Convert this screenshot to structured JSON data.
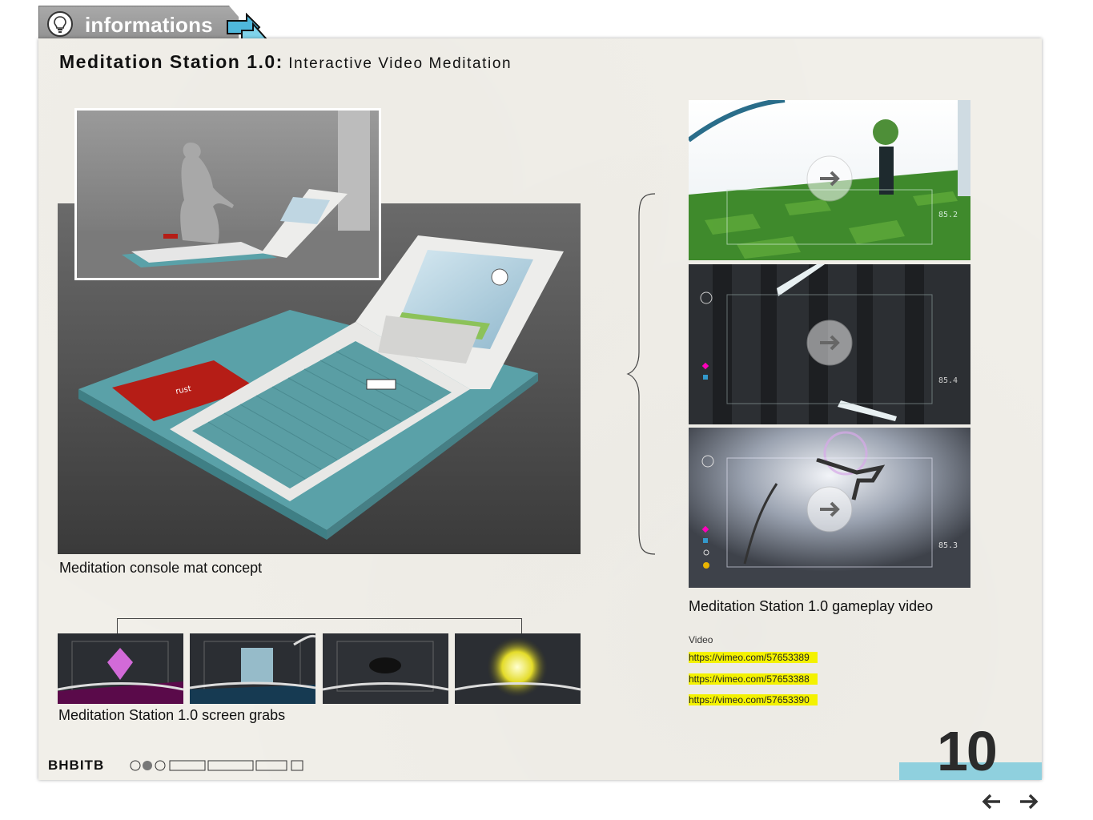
{
  "tab": {
    "label": "informations"
  },
  "header": {
    "title_main": "Meditation Station 1.0:",
    "title_sub": "Interactive Video Meditation"
  },
  "captions": {
    "mat": "Meditation console mat concept",
    "gameplay": "Meditation Station 1.0 gameplay video",
    "grabs": "Meditation Station 1.0 screen grabs"
  },
  "gameplay_frames": [
    {
      "readout": "85.2"
    },
    {
      "readout": "85.4"
    },
    {
      "readout": "85.3"
    }
  ],
  "video": {
    "label": "Video",
    "links": [
      "https://vimeo.com/57653389",
      "https://vimeo.com/57653388",
      "https://vimeo.com/57653390"
    ]
  },
  "footer": {
    "logo": "BHBITB",
    "page_number": "10"
  },
  "colors": {
    "accent": "#8fd0de",
    "highlight": "#f4f200",
    "mat_teal": "#5aa1a8",
    "mat_red": "#b51d16"
  }
}
